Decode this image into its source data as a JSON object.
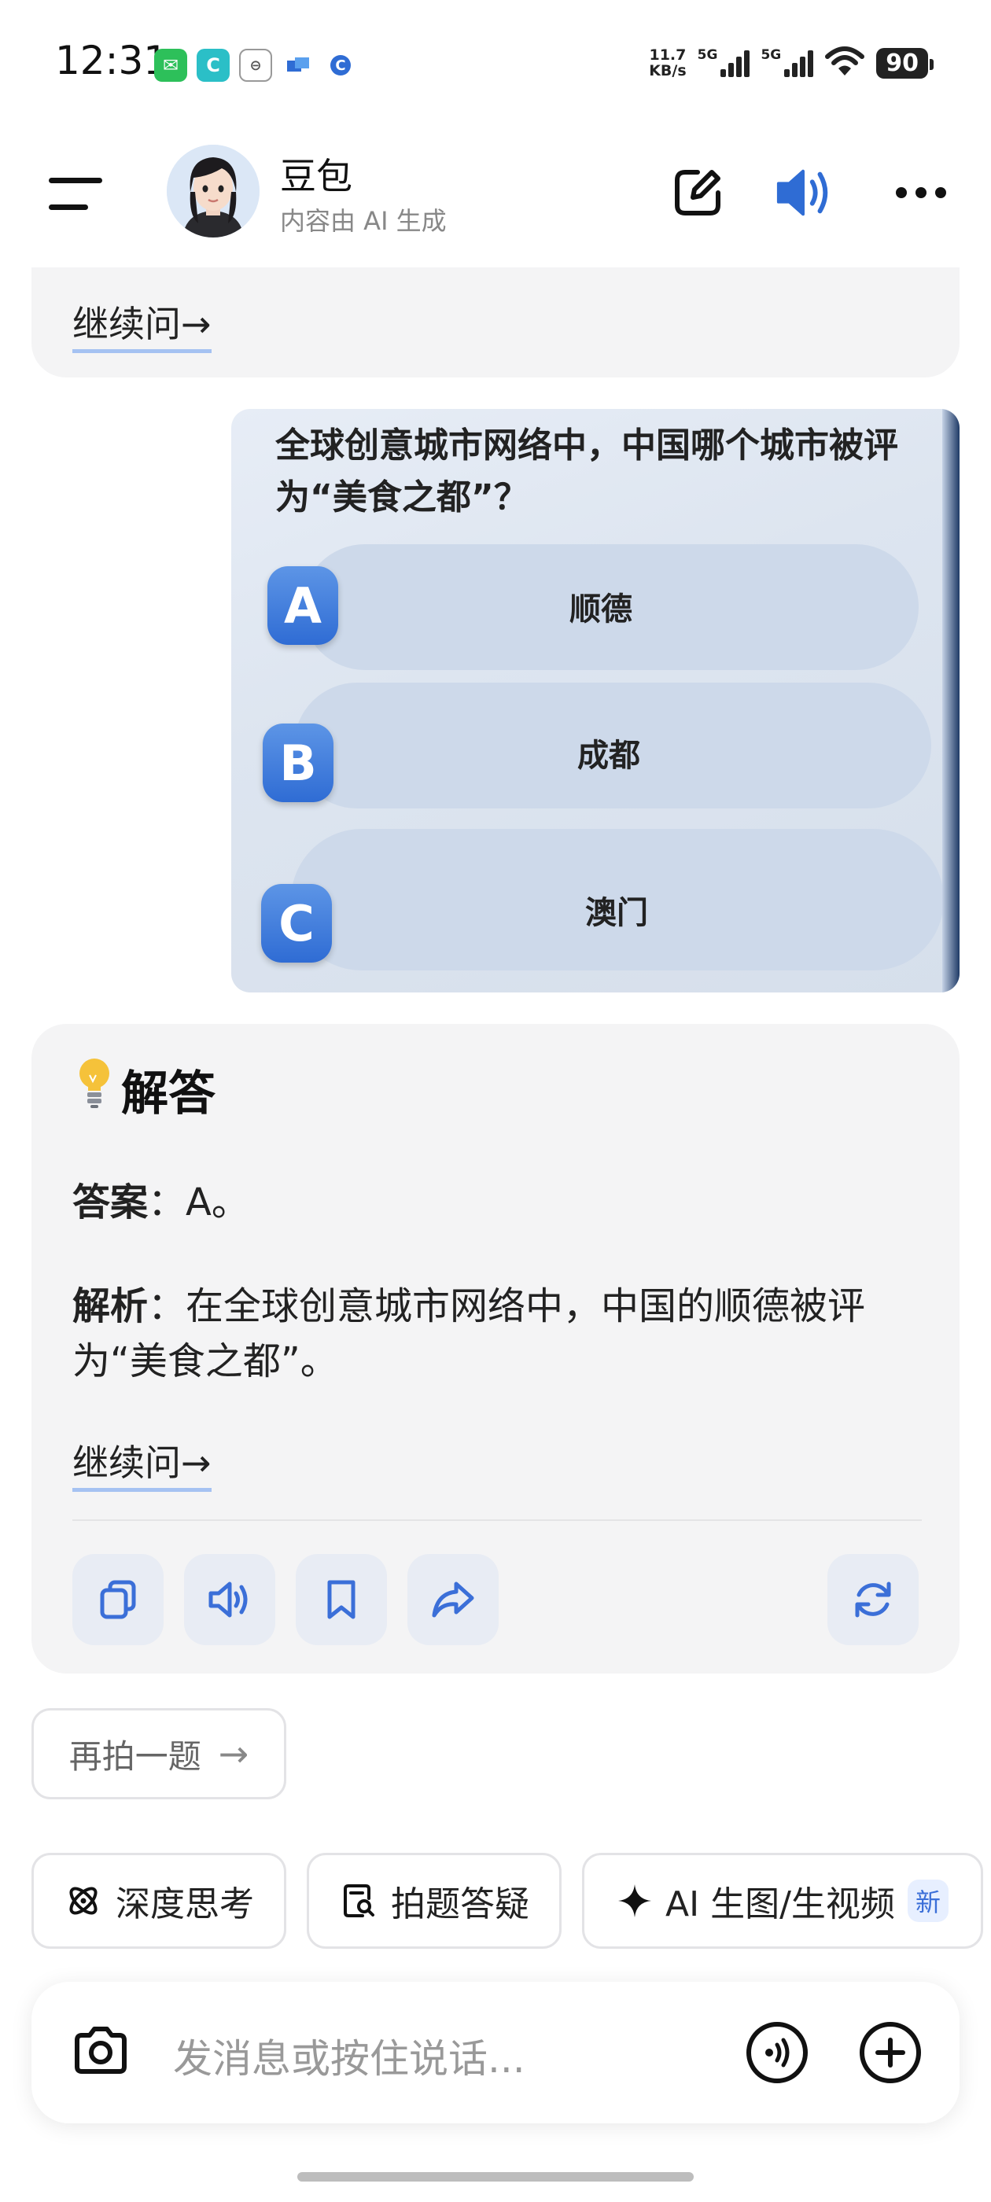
{
  "status_bar": {
    "time": "12:31",
    "net_speed_value": "11.7",
    "net_speed_unit": "KB/s",
    "signal_1_label": "5G",
    "signal_2_label": "5G",
    "battery": "90",
    "app_icons": [
      "wechat-icon",
      "app-c-icon",
      "app-circle-icon",
      "app-blue-icon",
      "app-c-blue-icon"
    ]
  },
  "header": {
    "bot_name": "豆包",
    "subtitle": "内容由 AI 生成"
  },
  "prev_card": {
    "continue_link": "继续问→"
  },
  "image_message": {
    "question": "全球创意城市网络中，中国哪个城市被评为“美食之都”？",
    "options": [
      {
        "letter": "A",
        "text": "顺德"
      },
      {
        "letter": "B",
        "text": "成都"
      },
      {
        "letter": "C",
        "text": "澳门"
      }
    ]
  },
  "answer_card": {
    "title_icon": "lightbulb-icon",
    "title": "解答",
    "answer_label": "答案",
    "answer_value": "：A。",
    "analysis_label": "解析",
    "analysis_value": "：在全球创意城市网络中，中国的顺德被评为“美食之都”。",
    "continue_link": "继续问→"
  },
  "retake_button": {
    "label": "再拍一题",
    "arrow": "→"
  },
  "chips": [
    {
      "label": "深度思考",
      "icon": "atom-icon"
    },
    {
      "label": "拍题答疑",
      "icon": "doc-search-icon"
    },
    {
      "label": "AI 生图/生视频",
      "icon": "sparkle-icon",
      "badge": "新"
    }
  ],
  "input": {
    "placeholder": "发消息或按住说话..."
  },
  "colors": {
    "accent": "#3b6fd8",
    "card_bg": "#f4f4f5"
  }
}
